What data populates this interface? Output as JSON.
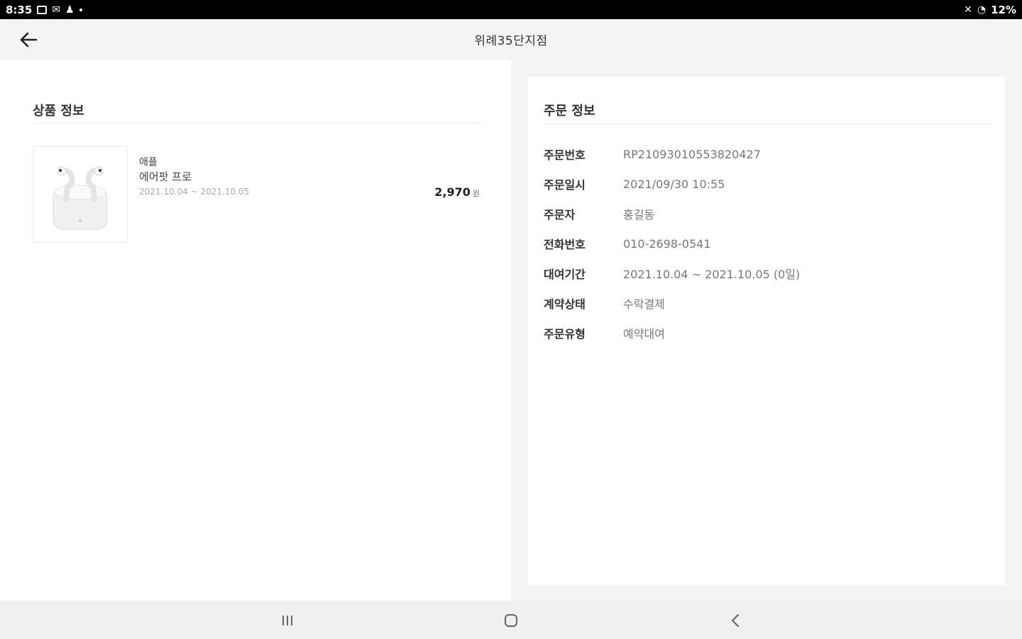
{
  "status_bar": {
    "time": "8:35",
    "battery": "12%"
  },
  "app_bar": {
    "title": "위례35단지점"
  },
  "product_section": {
    "title": "상품 정보",
    "item": {
      "brand": "애플",
      "name": "에어팟 프로",
      "period": "2021.10.04 ~ 2021.10.05",
      "price": "2,970",
      "currency": "원"
    }
  },
  "order_section": {
    "title": "주문 정보",
    "rows": [
      {
        "label": "주문번호",
        "value": "RP2109301055382042​7"
      },
      {
        "label": "주문일시",
        "value": "2021/09/30 10:55"
      },
      {
        "label": "주문자",
        "value": "홍길동"
      },
      {
        "label": "전화번호",
        "value": "010-2698-0541"
      },
      {
        "label": "대여기간",
        "value": "2021.10.04 ~ 2021.10.05 (0일)"
      },
      {
        "label": "계약상태",
        "value": "수락결제"
      },
      {
        "label": "주문유형",
        "value": "예약대여"
      }
    ]
  },
  "icons": {
    "back": "arrow-left-icon",
    "recents": "recents-icon",
    "home": "home-icon",
    "nav_back": "chevron-left-icon"
  }
}
